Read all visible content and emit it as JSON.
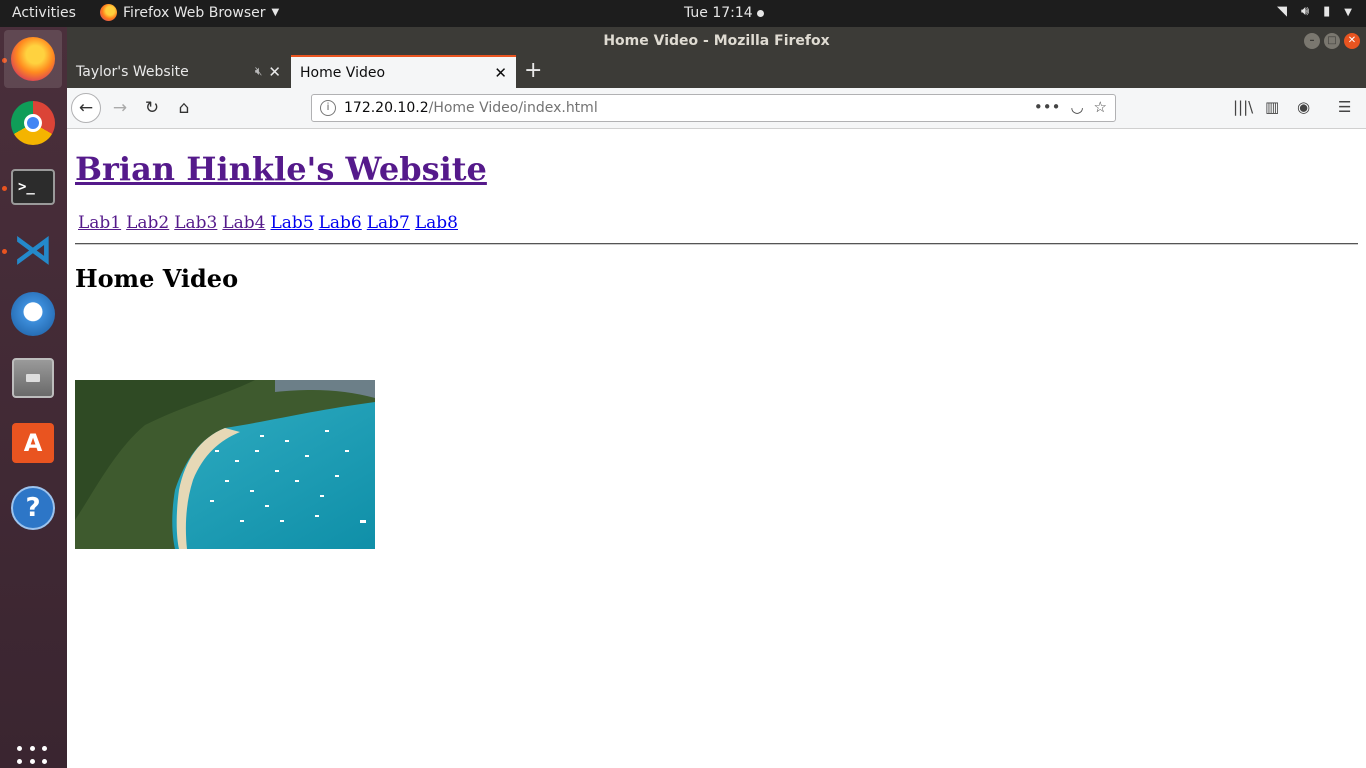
{
  "topbar": {
    "activities": "Activities",
    "app_menu": "Firefox Web Browser",
    "clock": "Tue 17:14"
  },
  "window": {
    "title": "Home Video - Mozilla Firefox"
  },
  "tabs": [
    {
      "label": "Taylor's Website",
      "active": false
    },
    {
      "label": "Home Video",
      "active": true
    }
  ],
  "urlbar": {
    "host": "172.20.10.2",
    "path": "/Home Video/index.html"
  },
  "page": {
    "site_title": "Brian Hinkle's Website",
    "labs": [
      {
        "label": "Lab1",
        "visited": true
      },
      {
        "label": "Lab2",
        "visited": true
      },
      {
        "label": "Lab3",
        "visited": true
      },
      {
        "label": "Lab4",
        "visited": true
      },
      {
        "label": "Lab5",
        "visited": false
      },
      {
        "label": "Lab6",
        "visited": false
      },
      {
        "label": "Lab7",
        "visited": false
      },
      {
        "label": "Lab8",
        "visited": false
      }
    ],
    "heading": "Home Video"
  },
  "dock": {
    "icons": [
      "firefox-icon",
      "chrome-icon",
      "terminal-icon",
      "vscode-icon",
      "thunderbird-icon",
      "files-icon",
      "software-store-icon",
      "help-icon",
      "show-apps-icon"
    ]
  },
  "colors": {
    "ubuntu_orange": "#e95420",
    "visited_link": "#551a8b",
    "unvisited_link": "#0000ee",
    "dock": "#3b2a33"
  }
}
